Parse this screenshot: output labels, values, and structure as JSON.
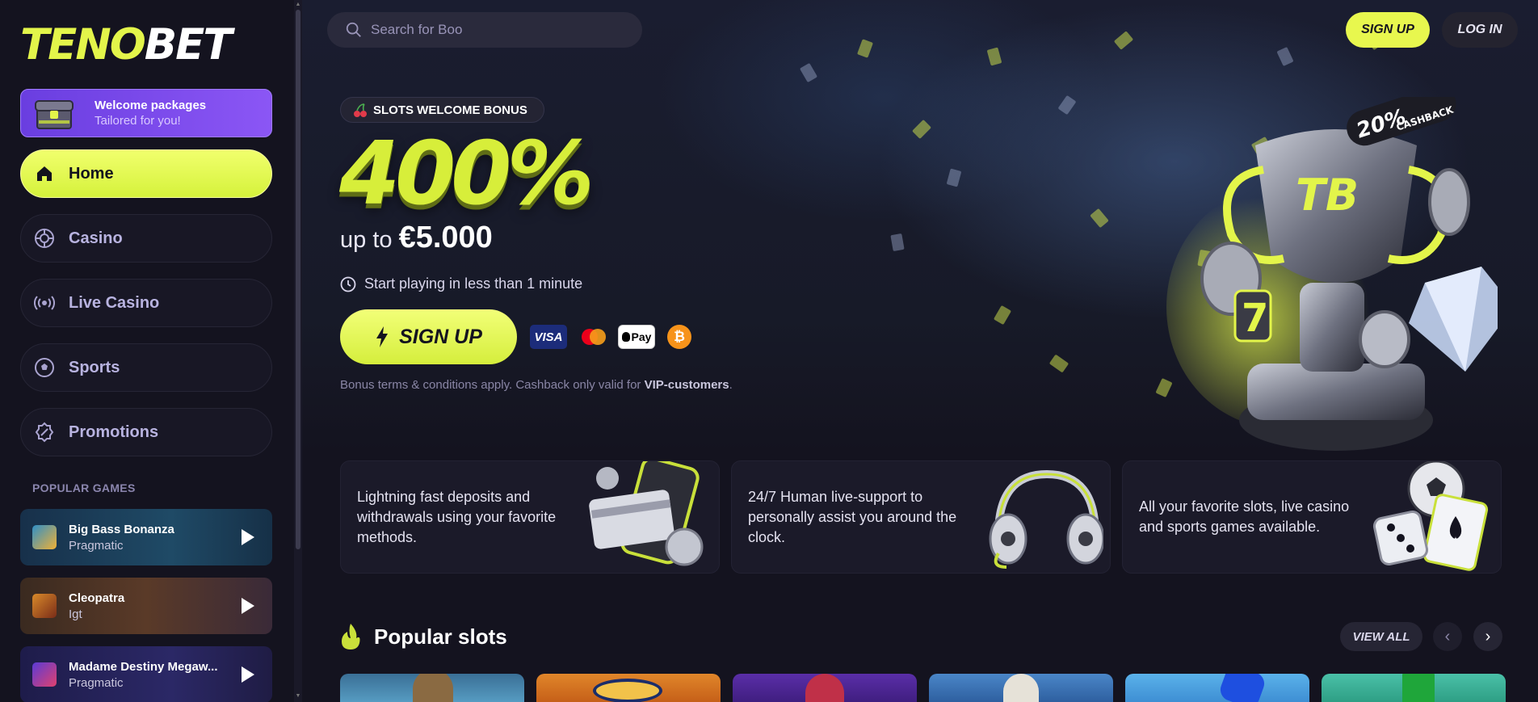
{
  "brand": {
    "logo_part1": "TENO",
    "logo_part2": "BET"
  },
  "sidebar": {
    "welcome": {
      "title": "Welcome packages",
      "subtitle": "Tailored for you!"
    },
    "nav": [
      {
        "label": "Home",
        "icon": "home-icon",
        "active": true
      },
      {
        "label": "Casino",
        "icon": "casino-chip-icon"
      },
      {
        "label": "Live Casino",
        "icon": "broadcast-icon"
      },
      {
        "label": "Sports",
        "icon": "soccer-ball-icon"
      },
      {
        "label": "Promotions",
        "icon": "discount-badge-icon"
      }
    ],
    "popular_title": "POPULAR GAMES",
    "games": [
      {
        "name": "Big Bass Bonanza",
        "provider": "Pragmatic"
      },
      {
        "name": "Cleopatra",
        "provider": "Igt"
      },
      {
        "name": "Madame Destiny Megaw...",
        "provider": "Pragmatic"
      }
    ]
  },
  "header": {
    "search_value": "Boo",
    "search_placeholder": "Search for",
    "signup": "SIGN UP",
    "login": "LOG IN"
  },
  "hero": {
    "badge": "SLOTS WELCOME BONUS",
    "percent": "400%",
    "upto_prefix": "up to",
    "upto_amount": "€5.000",
    "quick_text": "Start playing in less than 1 minute",
    "cta": "SIGN UP",
    "payments": {
      "visa": "VISA",
      "apple": "Pay",
      "btc": "₿"
    },
    "terms_prefix": "Bonus terms & conditions apply. Cashback only valid for ",
    "terms_link": "VIP-customers",
    "terms_suffix": ".",
    "cashback_percent": "20%",
    "cashback_label": "CASHBACK",
    "trophy_letters": "TB"
  },
  "features": [
    {
      "text": "Lightning fast deposits and withdrawals using your favorite methods."
    },
    {
      "text": "24/7 Human live-support to personally assist you around the clock."
    },
    {
      "text": "All your favorite slots, live casino and sports games available."
    }
  ],
  "popular_slots": {
    "title": "Popular slots",
    "view_all": "VIEW ALL"
  },
  "colors": {
    "accent": "#e3f54a",
    "purple": "#7a4bec",
    "bg": "#14131f"
  }
}
